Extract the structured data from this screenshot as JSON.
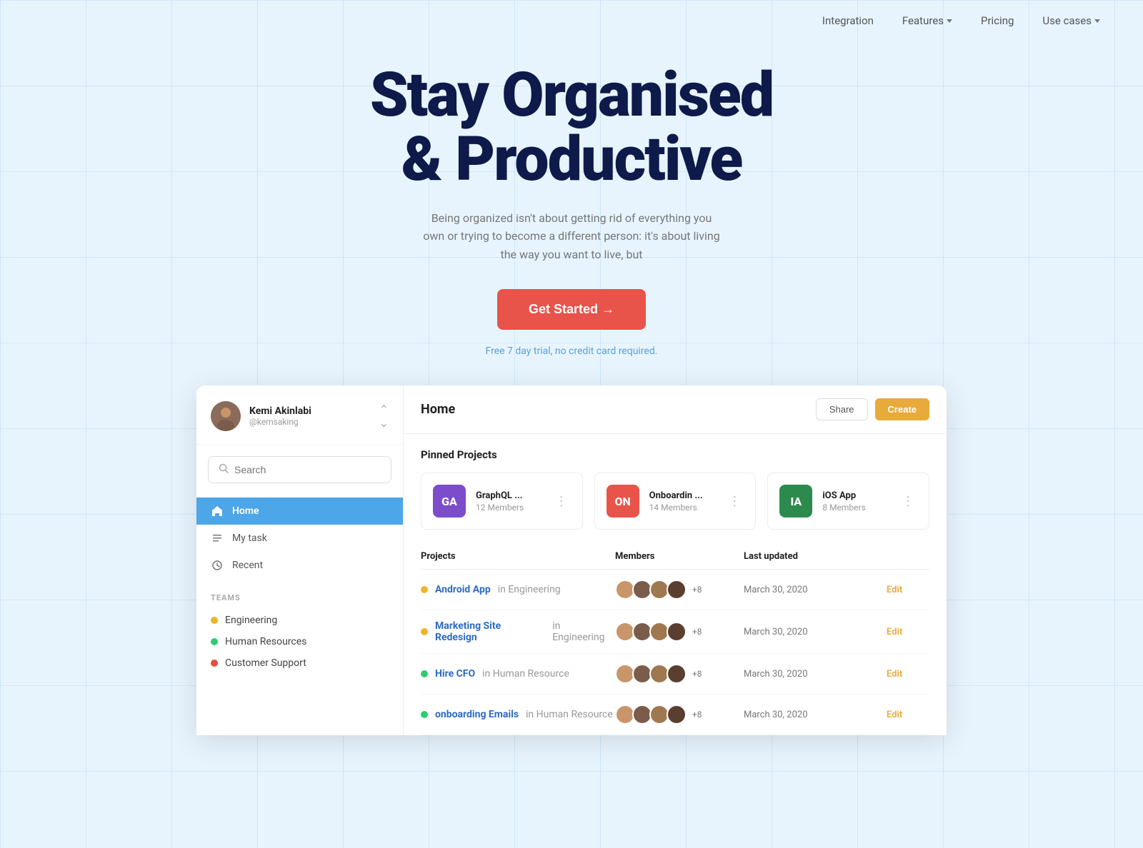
{
  "nav": {
    "items": [
      {
        "label": "Integration",
        "hasDropdown": false
      },
      {
        "label": "Features",
        "hasDropdown": true
      },
      {
        "label": "Pricing",
        "hasDropdown": false
      },
      {
        "label": "Use cases",
        "hasDropdown": true
      }
    ]
  },
  "hero": {
    "title_line1": "Stay Organised",
    "title_line2": "& Productive",
    "subtitle": "Being organized isn't about getting rid of everything you own or trying to become a different person: it's about living the way you want to live, but",
    "cta_label": "Get Started →",
    "trial_text": "Free 7 day trial, no credit card required."
  },
  "sidebar": {
    "user": {
      "name": "Kemi Akinlabi",
      "handle": "@kemsaking"
    },
    "search_placeholder": "Search",
    "nav_items": [
      {
        "label": "Home",
        "icon": "home",
        "active": true
      },
      {
        "label": "My task",
        "icon": "list",
        "active": false
      },
      {
        "label": "Recent",
        "icon": "clock",
        "active": false
      }
    ],
    "teams_label": "TEAMS",
    "teams": [
      {
        "label": "Engineering",
        "color": "#f0b429"
      },
      {
        "label": "Human Resources",
        "color": "#2ecc71"
      },
      {
        "label": "Customer Support",
        "color": "#e74c3c"
      }
    ]
  },
  "main": {
    "title": "Home",
    "share_label": "Share",
    "create_label": "Create",
    "pinned_title": "Pinned Projects",
    "pinned_projects": [
      {
        "abbr": "GA",
        "color": "#7c4dca",
        "name": "GraphQL ...",
        "members": "12 Members"
      },
      {
        "abbr": "ON",
        "color": "#e8534a",
        "name": "Onboardin ...",
        "members": "14 Members"
      },
      {
        "abbr": "IA",
        "color": "#2d8a4e",
        "name": "iOS App",
        "members": "8 Members"
      }
    ],
    "table_headers": [
      "Projects",
      "Members",
      "Last updated",
      ""
    ],
    "projects": [
      {
        "status_color": "#f0b429",
        "name": "Android App",
        "team": "in Engineering",
        "members_count": "+8",
        "date": "March 30, 2020"
      },
      {
        "status_color": "#f0b429",
        "name": "Marketing Site Redesign",
        "team": "in Engineering",
        "members_count": "+8",
        "date": "March 30, 2020"
      },
      {
        "status_color": "#2ecc71",
        "name": "Hire CFO",
        "team": "in Human Resource",
        "members_count": "+8",
        "date": "March 30, 2020"
      },
      {
        "status_color": "#2ecc71",
        "name": "onboarding Emails",
        "team": "in Human Resource",
        "members_count": "+8",
        "date": "March 30, 2020"
      }
    ],
    "edit_label": "Edit"
  }
}
